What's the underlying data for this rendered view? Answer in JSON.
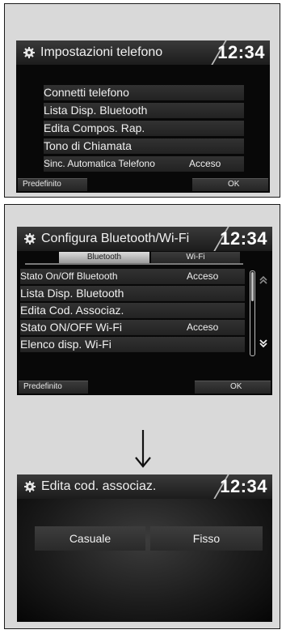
{
  "screen1": {
    "title": "Impostazioni telefono",
    "clock": "12:34",
    "items": [
      {
        "label": "Connetti telefono",
        "value": ""
      },
      {
        "label": "Lista Disp. Bluetooth",
        "value": ""
      },
      {
        "label": "Edita Compos. Rap.",
        "value": ""
      },
      {
        "label": "Tono di Chiamata",
        "value": ""
      },
      {
        "label": "Sinc. Automatica Telefono",
        "value": "Acceso"
      }
    ],
    "default_button": "Predefinito",
    "ok_button": "OK"
  },
  "screen2": {
    "title": "Configura Bluetooth/Wi-Fi",
    "clock": "12:34",
    "tabs": [
      "Bluetooth",
      "Wi-Fi"
    ],
    "items": [
      {
        "label": "Stato On/Off Bluetooth",
        "value": "Acceso"
      },
      {
        "label": "Lista Disp. Bluetooth",
        "value": ""
      },
      {
        "label": "Edita Cod. Associaz.",
        "value": ""
      },
      {
        "label": "Stato ON/OFF Wi-Fi",
        "value": "Acceso"
      },
      {
        "label": "Elenco disp. Wi-Fi",
        "value": ""
      }
    ],
    "default_button": "Predefinito",
    "ok_button": "OK"
  },
  "screen3": {
    "title": "Edita cod. associaz.",
    "clock": "12:34",
    "options": [
      "Casuale",
      "Fisso"
    ]
  },
  "icons": {
    "gear": "gear-icon",
    "scroll_up": "double-chevron-up-icon",
    "scroll_down": "double-chevron-down-icon",
    "arrow": "arrow-down-icon"
  }
}
